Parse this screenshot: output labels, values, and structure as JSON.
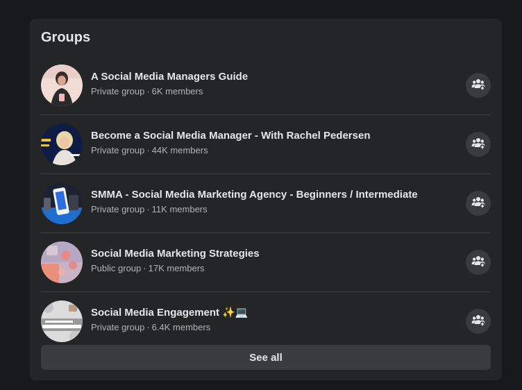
{
  "card": {
    "title": "Groups",
    "see_all_label": "See all"
  },
  "groups": [
    {
      "name": "A Social Media Managers Guide",
      "privacy": "Private group",
      "members": "6K members",
      "avatar": "avatar-woman-pink"
    },
    {
      "name": "Become a Social Media Manager - With Rachel Pedersen",
      "privacy": "Private group",
      "members": "44K members",
      "avatar": "avatar-woman-navy"
    },
    {
      "name": "SMMA - Social Media Marketing Agency - Beginners / Intermediate",
      "privacy": "Private group",
      "members": "11K members",
      "avatar": "avatar-phone-blue"
    },
    {
      "name": "Social Media Marketing Strategies",
      "privacy": "Public group",
      "members": "17K members",
      "avatar": "avatar-pastel-pink"
    },
    {
      "name": "Social Media Engagement",
      "name_emoji": "✨💻",
      "privacy": "Private group",
      "members": "6.4K members",
      "avatar": "avatar-engagement-logo"
    }
  ],
  "icons": {
    "join": "group-join-icon"
  },
  "colors": {
    "page_bg": "#18191a",
    "card_bg": "#242526",
    "button_bg": "#3a3b3c",
    "primary_text": "#e4e6eb",
    "secondary_text": "#b0b3b8",
    "divider": "#3e4042"
  }
}
